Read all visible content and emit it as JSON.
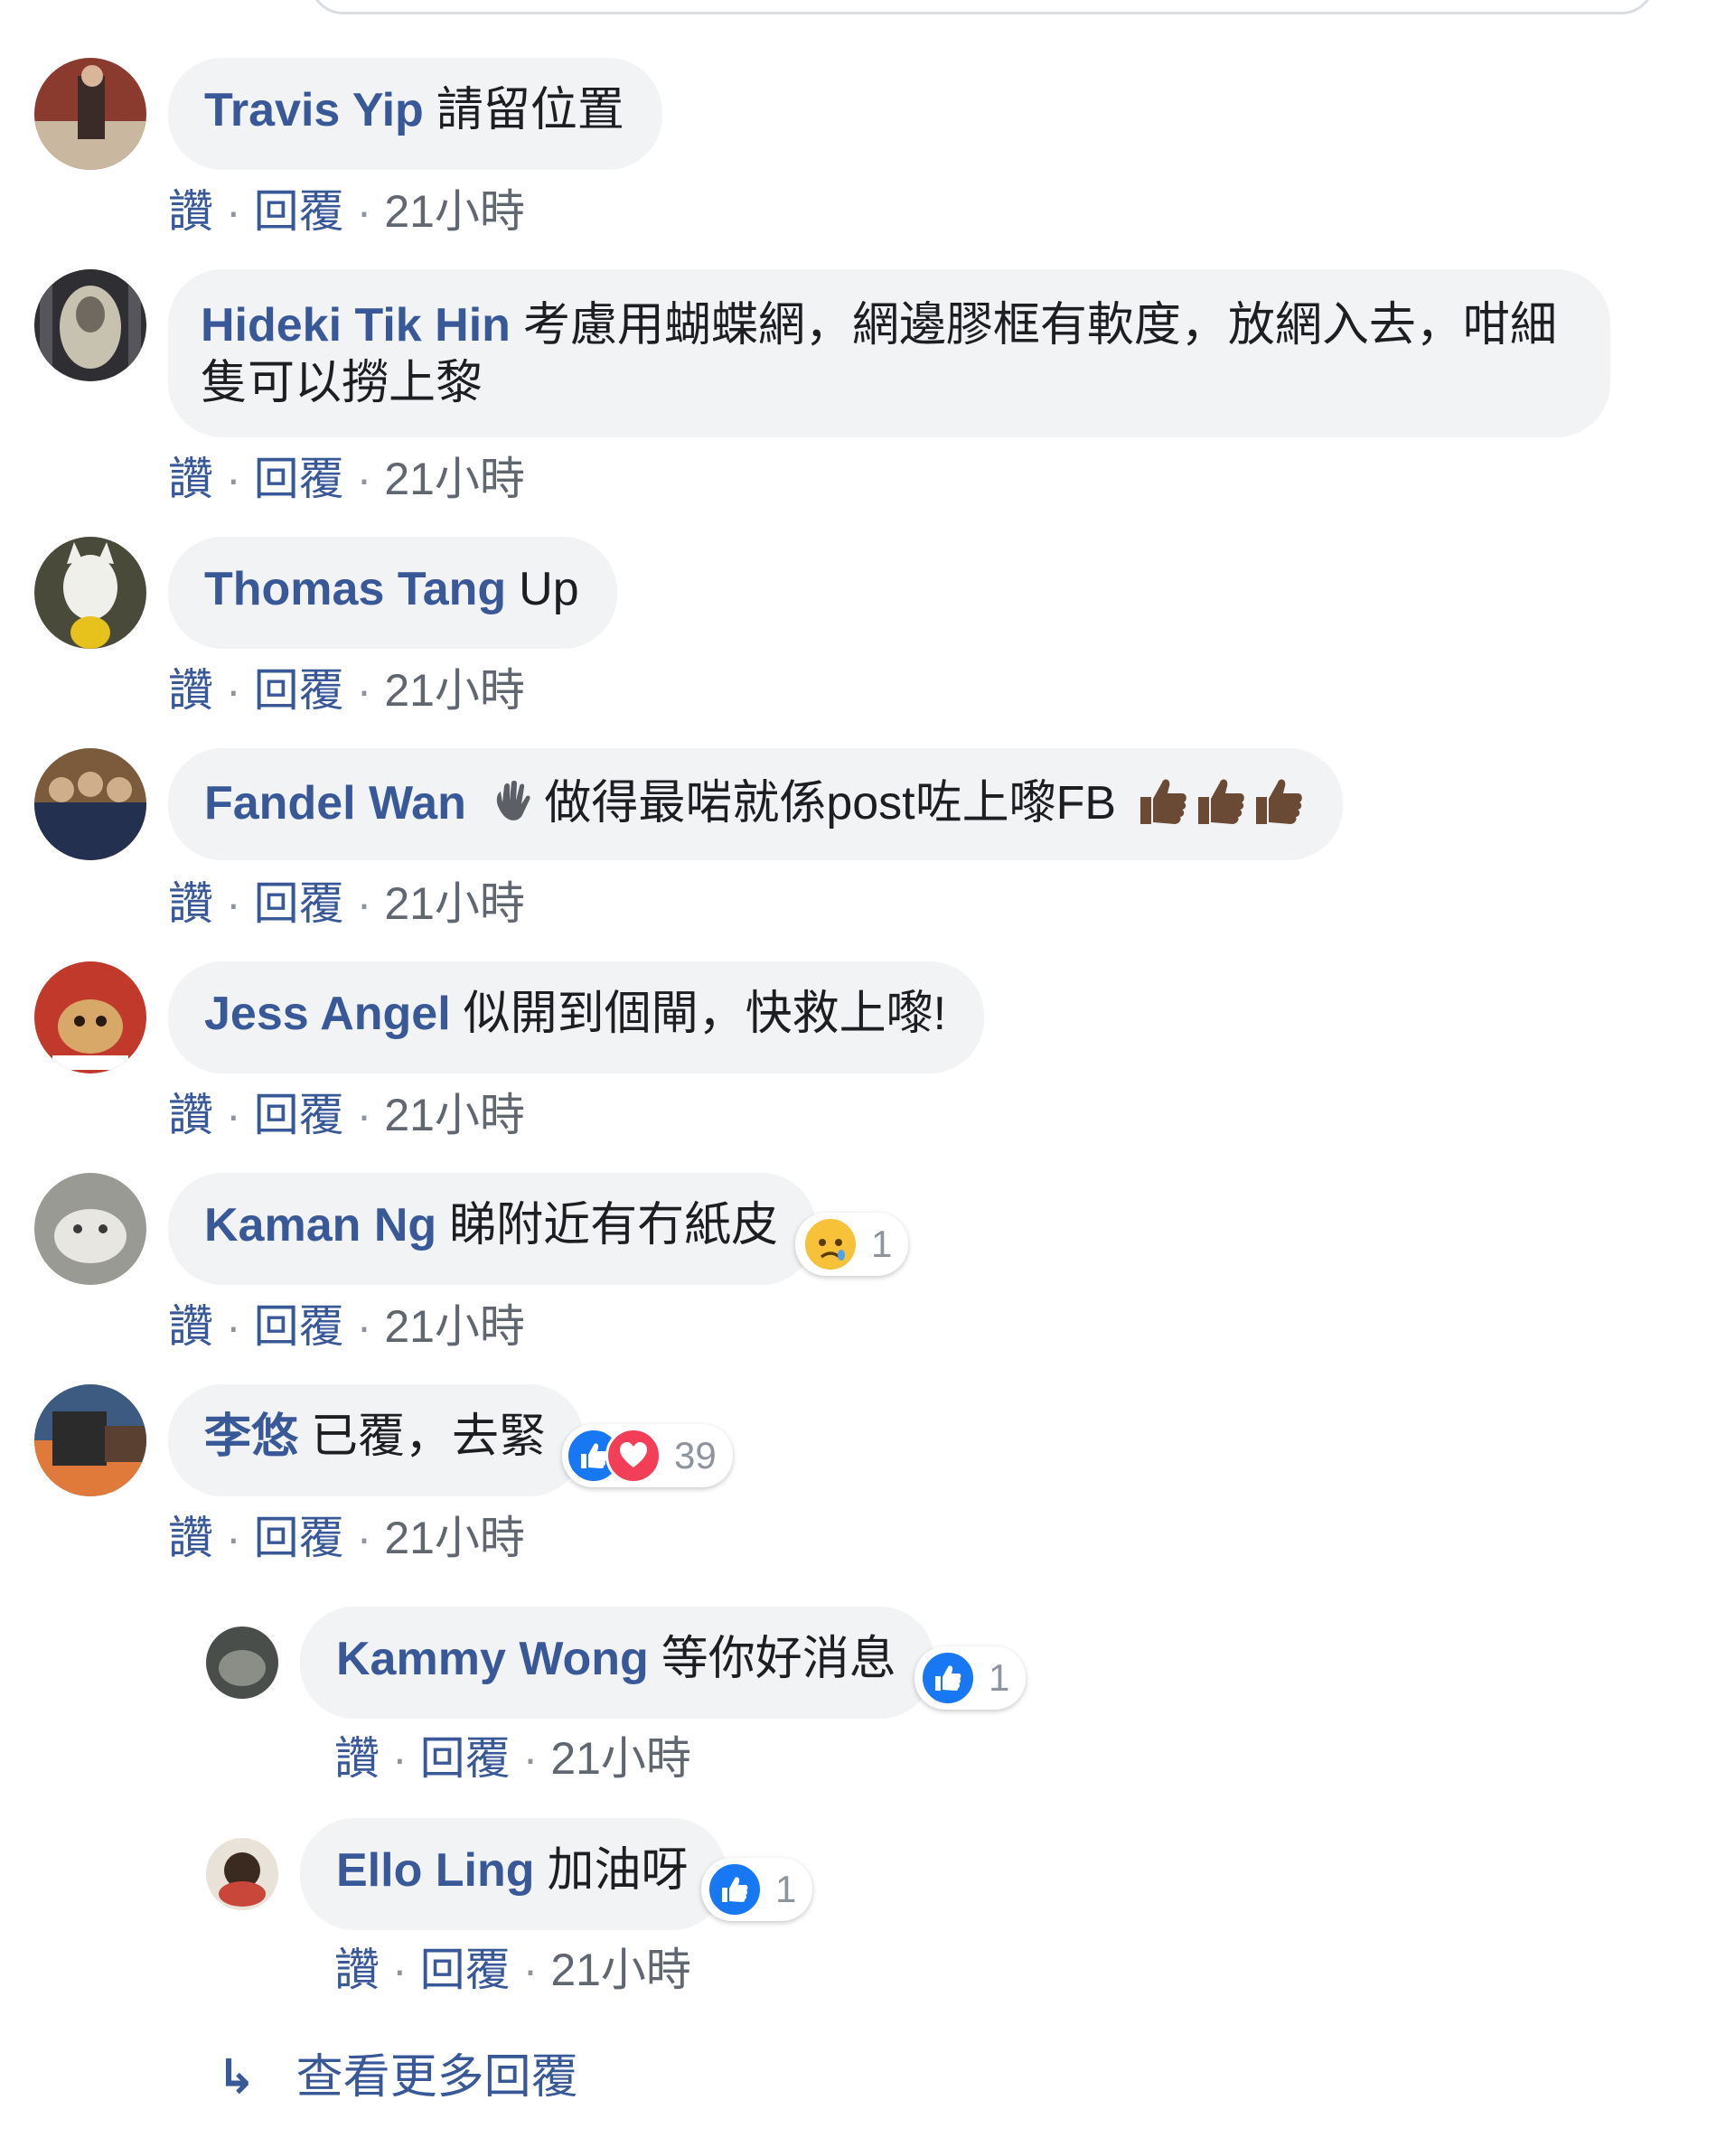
{
  "comments": [
    {
      "name": "Travis Yip",
      "text": "請留位置",
      "like": "讚",
      "reply": "回覆",
      "time": "21小時"
    },
    {
      "name": "Hideki Tik Hin",
      "text": "考慮用蝴蝶網，網邊膠框有軟度，放網入去，咁細隻可以撈上黎",
      "like": "讚",
      "reply": "回覆",
      "time": "21小時"
    },
    {
      "name": "Thomas Tang",
      "text": "Up",
      "like": "讚",
      "reply": "回覆",
      "time": "21小時"
    },
    {
      "name": "Fandel Wan",
      "text": "做得最啱就係post咗上嚟FB",
      "like": "讚",
      "reply": "回覆",
      "time": "21小時"
    },
    {
      "name": "Jess Angel",
      "text": "似開到個閘，快救上嚟!",
      "like": "讚",
      "reply": "回覆",
      "time": "21小時"
    },
    {
      "name": "Kaman Ng",
      "text": "睇附近有冇紙皮",
      "like": "讚",
      "reply": "回覆",
      "time": "21小時",
      "reaction_count": "1"
    },
    {
      "name": "李悠",
      "text": "已覆，去緊",
      "like": "讚",
      "reply": "回覆",
      "time": "21小時",
      "reaction_count": "39"
    }
  ],
  "replies": [
    {
      "name": "Kammy Wong",
      "text": "等你好消息",
      "like": "讚",
      "reply": "回覆",
      "time": "21小時",
      "reaction_count": "1"
    },
    {
      "name": "Ello Ling",
      "text": "加油呀",
      "like": "讚",
      "reply": "回覆",
      "time": "21小時",
      "reaction_count": "1"
    }
  ],
  "more_replies_label": "查看更多回覆",
  "more_replies_arrow": "↳",
  "separator": "·",
  "colors": {
    "name": "#385898",
    "bubble": "#f2f3f5",
    "like": "#1877f2",
    "love": "#f33e58",
    "sad": "#f7c23a"
  }
}
